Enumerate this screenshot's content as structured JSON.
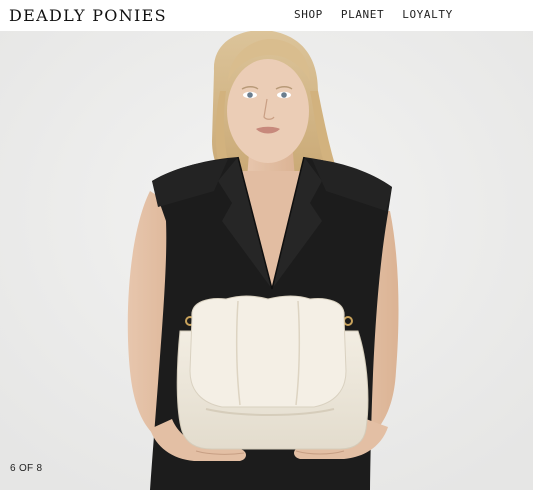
{
  "header": {
    "logo": "DEADLY PONIES",
    "nav": [
      {
        "label": "SHOP"
      },
      {
        "label": "PLANET"
      },
      {
        "label": "LOYALTY"
      }
    ]
  },
  "hero": {
    "slide_counter": "6 OF 8"
  }
}
